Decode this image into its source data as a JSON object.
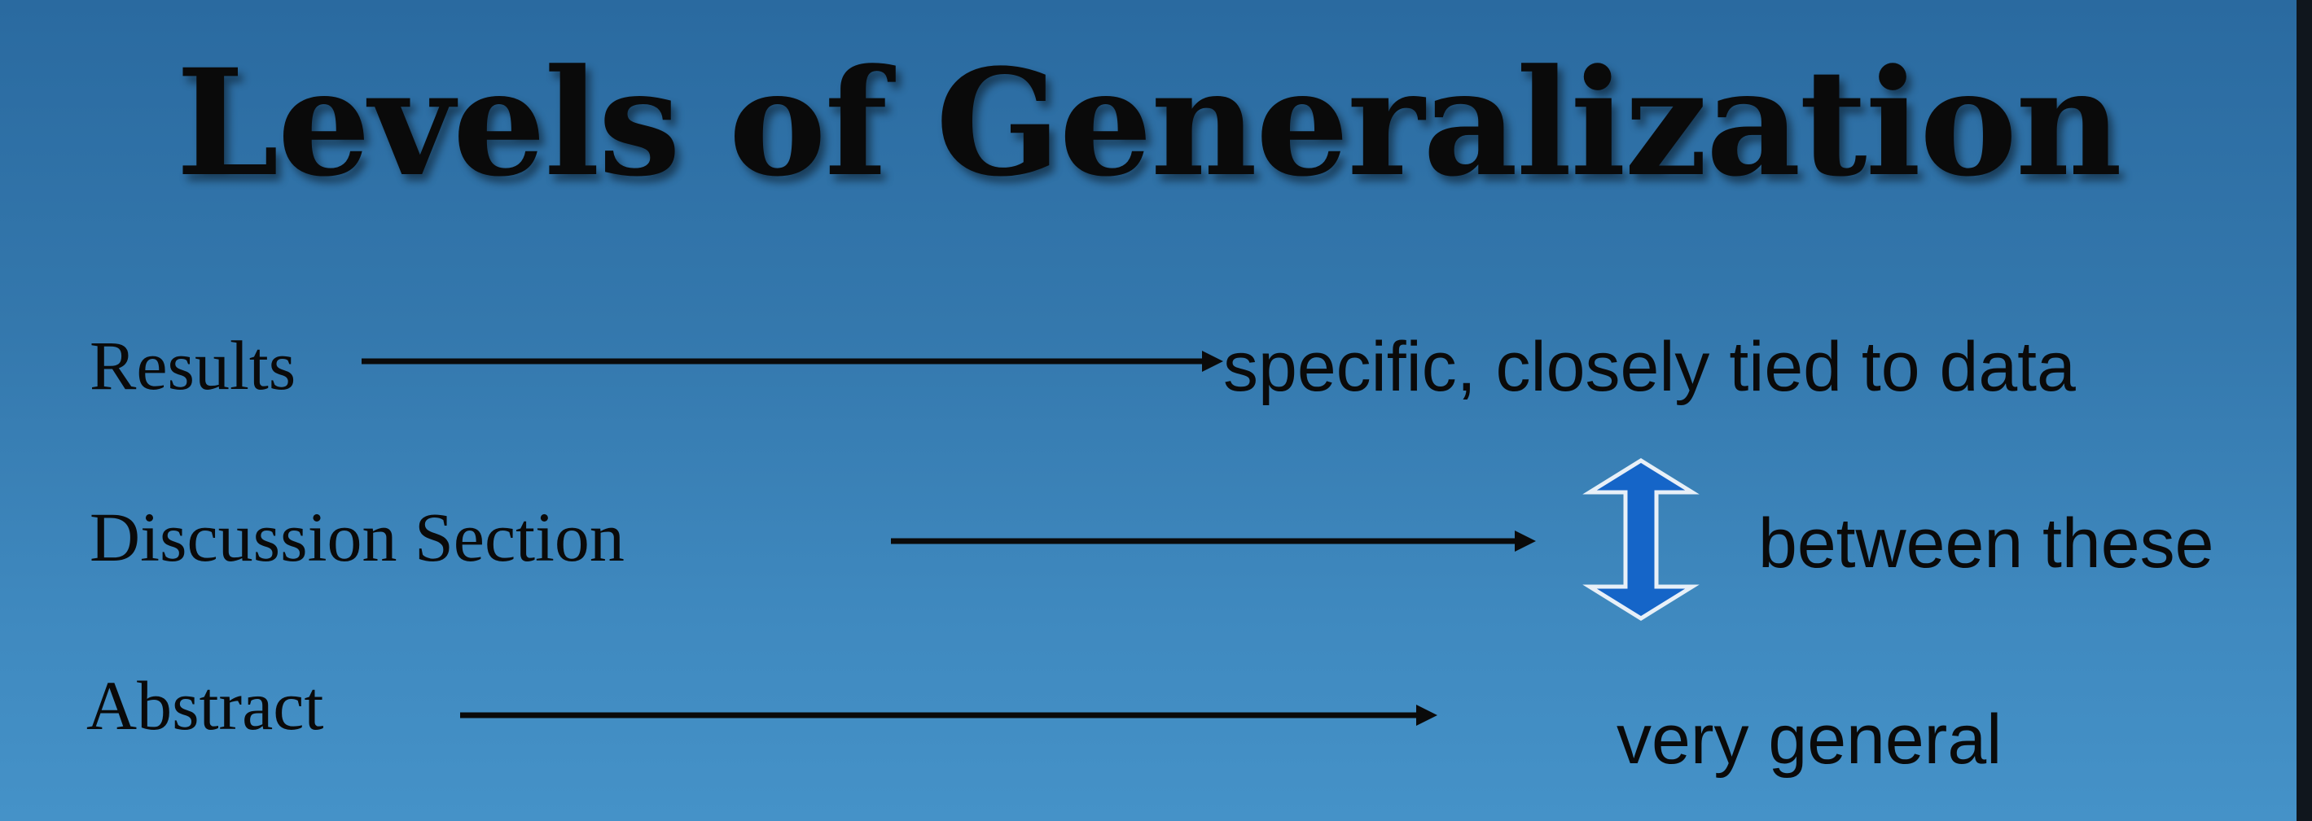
{
  "slide": {
    "title": "Levels of Generalization",
    "rows": [
      {
        "label": "Results",
        "description": "specific, closely tied to data"
      },
      {
        "label": "Discussion Section",
        "description": "between these"
      },
      {
        "label": "Abstract",
        "description": "very general"
      }
    ]
  },
  "icons": {
    "row_arrow": "right-arrow-icon",
    "range_arrow": "double-vertical-arrow-icon"
  },
  "colors": {
    "background_top": "#2a6aa0",
    "background_bottom": "#4592c8",
    "text": "#0a0a0a",
    "double_arrow_fill": "#1565c8",
    "double_arrow_outline": "#e8f0f8"
  }
}
